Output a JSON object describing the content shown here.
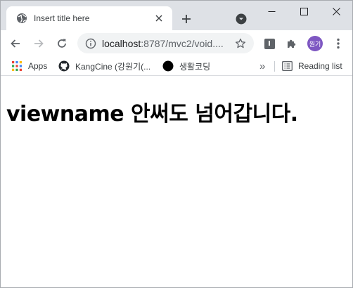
{
  "browser": {
    "tab": {
      "title": "Insert title here"
    },
    "address_bar": {
      "host": "localhost",
      "path": ":8787/mvc2/void...."
    },
    "profile": {
      "initials": "원기"
    },
    "extension_letter": "I"
  },
  "bookmarks": {
    "apps_label": "Apps",
    "items": [
      {
        "label": "KangCine (강원기(...",
        "icon": "github-icon"
      },
      {
        "label": "생활코딩",
        "icon": "black-circle-icon"
      }
    ],
    "overflow": "»",
    "reading_list_label": "Reading list"
  },
  "page": {
    "heading": "viewname 안써도 넘어갑니다."
  },
  "colors": {
    "tabstrip": "#dee1e6",
    "omnibox": "#f1f3f4",
    "avatar": "#7e57c2"
  }
}
